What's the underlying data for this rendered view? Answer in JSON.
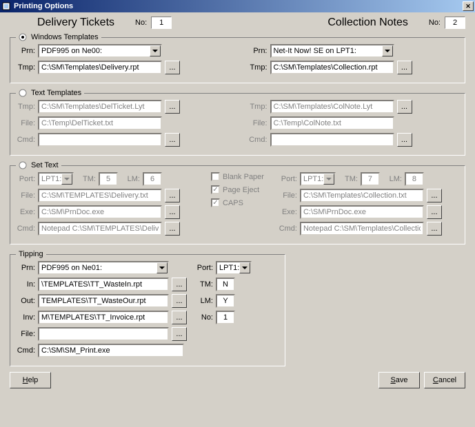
{
  "window": {
    "title": "Printing Options"
  },
  "header": {
    "delivery_title": "Delivery Tickets",
    "collection_title": "Collection Notes",
    "no_label": "No:",
    "delivery_no": "1",
    "collection_no": "2"
  },
  "sections": {
    "windows_templates": {
      "legend": "Windows Templates",
      "prn_label": "Prn:",
      "tmp_label": "Tmp:",
      "left": {
        "prn": "PDF995 on Ne00:",
        "tmp": "C:\\SM\\Templates\\Delivery.rpt"
      },
      "right": {
        "prn": "Net-It Now! SE on LPT1:",
        "tmp": "C:\\SM\\Templates\\Collection.rpt"
      },
      "browse": "..."
    },
    "text_templates": {
      "legend": "Text Templates",
      "tmp_label": "Tmp:",
      "file_label": "File:",
      "cmd_label": "Cmd:",
      "left": {
        "tmp": "C:\\SM\\Templates\\DelTicket.Lyt",
        "file": "C:\\Temp\\DelTicket.txt",
        "cmd": ""
      },
      "right": {
        "tmp": "C:\\SM\\Templates\\ColNote.Lyt",
        "file": "C:\\Temp\\ColNote.txt",
        "cmd": ""
      },
      "browse": "..."
    },
    "set_text": {
      "legend": "Set Text",
      "port_label": "Port:",
      "tm_label": "TM:",
      "lm_label": "LM:",
      "file_label": "File:",
      "exe_label": "Exe:",
      "cmd_label": "Cmd:",
      "left": {
        "port": "LPT1:",
        "tm": "5",
        "lm": "6",
        "file": "C:\\SM\\TEMPLATES\\Delivery.txt",
        "exe": "C:\\SM\\PrnDoc.exe",
        "cmd": "Notepad C:\\SM\\TEMPLATES\\Delive"
      },
      "right": {
        "port": "LPT1:",
        "tm": "7",
        "lm": "8",
        "file": "C:\\SM\\Templates\\Collection.txt",
        "exe": "C:\\SM\\PrnDoc.exe",
        "cmd": "Notepad C:\\SM\\Templates\\Collection"
      },
      "checks": {
        "blank_paper": "Blank Paper",
        "page_eject": "Page Eject",
        "caps": "CAPS"
      },
      "browse": "..."
    },
    "tipping": {
      "legend": "Tipping",
      "prn_label": "Prn:",
      "in_label": "In:",
      "out_label": "Out:",
      "inv_label": "Inv:",
      "file_label": "File:",
      "cmd_label": "Cmd:",
      "port_label": "Port:",
      "tm_label": "TM:",
      "lm_label": "LM:",
      "no_label": "No:",
      "prn": "PDF995 on Ne01:",
      "in": "\\TEMPLATES\\TT_WasteIn.rpt",
      "out": "TEMPLATES\\TT_WasteOur.rpt",
      "inv": "M\\TEMPLATES\\TT_Invoice.rpt",
      "file": "",
      "cmd": "C:\\SM\\SM_Print.exe",
      "port": "LPT1:",
      "tm": "N",
      "lm": "Y",
      "no": "1",
      "browse": "..."
    }
  },
  "buttons": {
    "help": "Help",
    "save": "Save",
    "cancel": "Cancel"
  }
}
